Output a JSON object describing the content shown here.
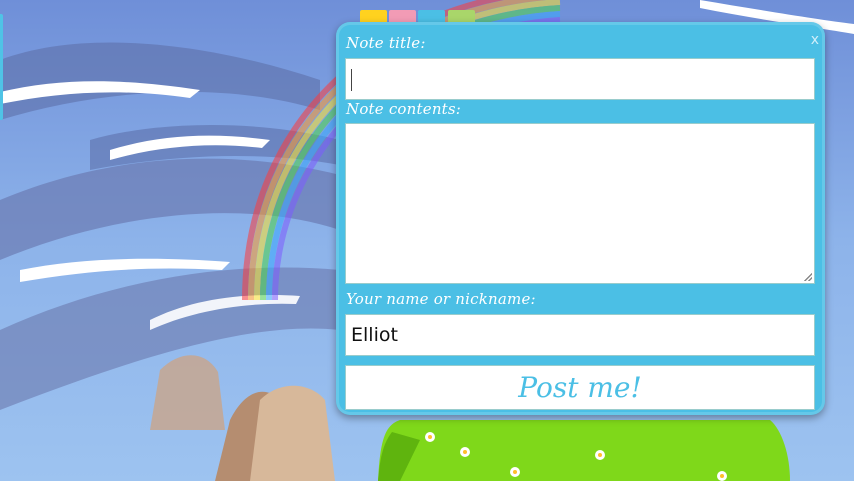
{
  "note_form": {
    "close_label": "x",
    "title_label": "Note title:",
    "title_value": "",
    "contents_label": "Note contents:",
    "contents_value": "",
    "name_label": "Your name or nickname:",
    "name_value": "Elliot",
    "post_label": "Post me!"
  },
  "color_tabs": [
    {
      "color": "#ffd21f"
    },
    {
      "color": "#f29bb5"
    },
    {
      "color": "#4bbfe5"
    },
    {
      "color": "#a9d66a"
    }
  ],
  "theme": {
    "panel_color": "#4bbfe5",
    "sky_color": "#7fa8e6",
    "grass_color": "#7fd81a"
  }
}
